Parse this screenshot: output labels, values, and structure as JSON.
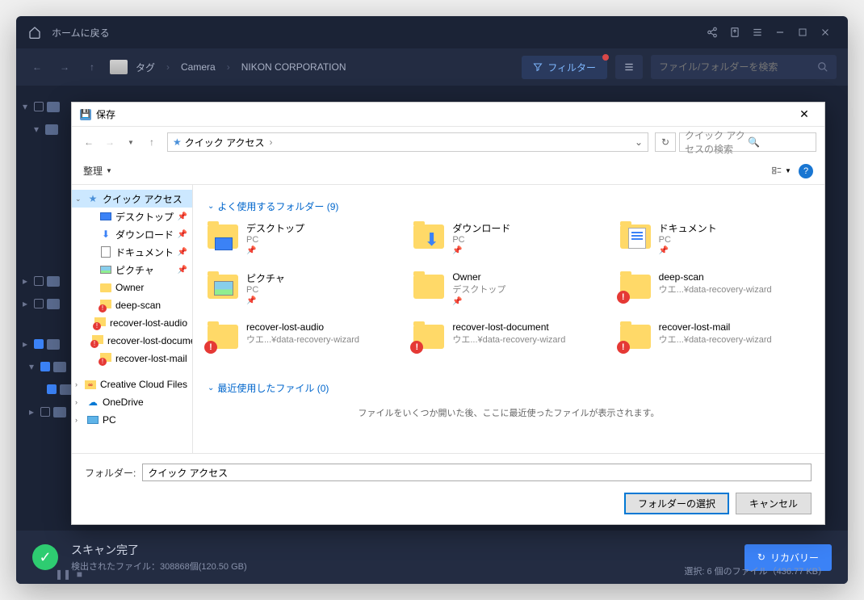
{
  "app": {
    "home_label": "ホームに戻る",
    "path": {
      "tag": "タグ",
      "seg1": "Camera",
      "seg2": "NIKON CORPORATION"
    },
    "filter_label": "フィルター",
    "search_placeholder": "ファイル/フォルダーを検索",
    "status": {
      "title": "スキャン完了",
      "detail": "検出されたファイル：308868個(120.50 GB)",
      "recovery_btn": "リカバリー",
      "selection": "選択: 6 個のファイル（436.77 KB）"
    }
  },
  "dialog": {
    "title": "保存",
    "addr_text": "クイック アクセス",
    "addr_sep": "›",
    "search_placeholder": "クイック アクセスの検索",
    "organize": "整理",
    "sidebar": [
      {
        "label": "クイック アクセス",
        "icon": "star",
        "sel": true,
        "expandable": true,
        "expanded": true
      },
      {
        "label": "デスクトップ",
        "icon": "desktop",
        "pin": true,
        "indent": 1
      },
      {
        "label": "ダウンロード",
        "icon": "download",
        "pin": true,
        "indent": 1
      },
      {
        "label": "ドキュメント",
        "icon": "doc",
        "pin": true,
        "indent": 1
      },
      {
        "label": "ピクチャ",
        "icon": "pic",
        "pin": true,
        "indent": 1
      },
      {
        "label": "Owner",
        "icon": "folder",
        "indent": 1
      },
      {
        "label": "deep-scan",
        "icon": "warn",
        "indent": 1
      },
      {
        "label": "recover-lost-audio",
        "icon": "warn",
        "indent": 1
      },
      {
        "label": "recover-lost-document",
        "icon": "warn",
        "indent": 1
      },
      {
        "label": "recover-lost-mail",
        "icon": "warn",
        "indent": 1
      },
      {
        "label": "Creative Cloud Files",
        "icon": "cc",
        "expandable": true,
        "expanded": false
      },
      {
        "label": "OneDrive",
        "icon": "od",
        "expandable": true,
        "expanded": false
      },
      {
        "label": "PC",
        "icon": "pc",
        "expandable": true,
        "expanded": false
      }
    ],
    "section_freq": "よく使用するフォルダー (9)",
    "section_recent": "最近使用したファイル (0)",
    "empty_msg": "ファイルをいくつか開いた後、ここに最近使ったファイルが表示されます。",
    "folders": [
      {
        "name": "デスクトップ",
        "sub": "PC",
        "type": "desktop",
        "pin": true
      },
      {
        "name": "ダウンロード",
        "sub": "PC",
        "type": "download",
        "pin": true
      },
      {
        "name": "ドキュメント",
        "sub": "PC",
        "type": "doc",
        "pin": true
      },
      {
        "name": "ピクチャ",
        "sub": "PC",
        "type": "pic",
        "pin": true
      },
      {
        "name": "Owner",
        "sub": "デスクトップ",
        "type": "folder",
        "pin": true
      },
      {
        "name": "deep-scan",
        "sub": "ウエ...¥data-recovery-wizard",
        "type": "warn"
      },
      {
        "name": "recover-lost-audio",
        "sub": "ウエ...¥data-recovery-wizard",
        "type": "warn"
      },
      {
        "name": "recover-lost-document",
        "sub": "ウエ...¥data-recovery-wizard",
        "type": "warn"
      },
      {
        "name": "recover-lost-mail",
        "sub": "ウエ...¥data-recovery-wizard",
        "type": "warn"
      }
    ],
    "folder_label": "フォルダー:",
    "folder_value": "クイック アクセス",
    "btn_select": "フォルダーの選択",
    "btn_cancel": "キャンセル"
  }
}
